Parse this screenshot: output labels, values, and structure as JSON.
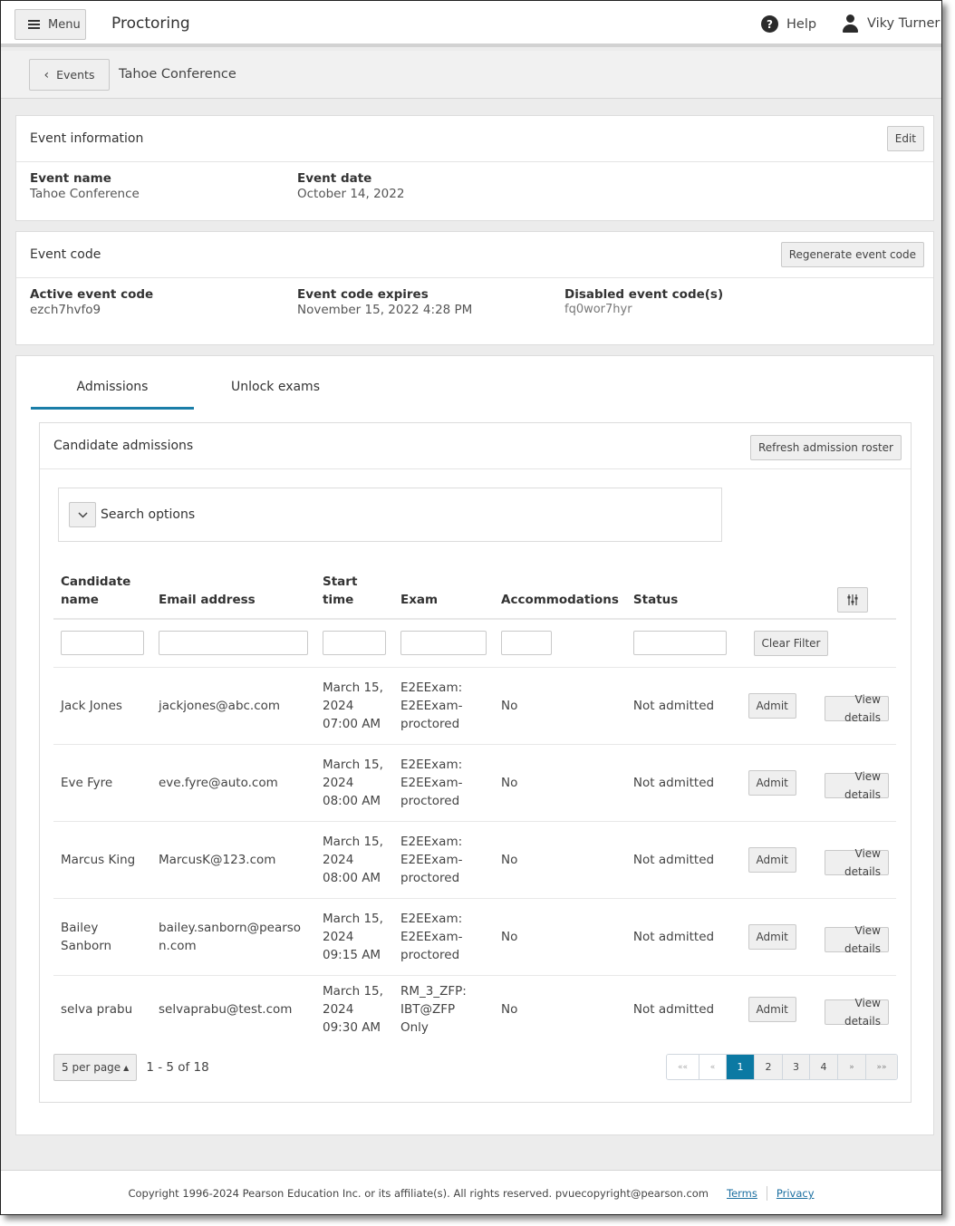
{
  "header": {
    "menu_label": "Menu",
    "app_title": "Proctoring",
    "help_label": "Help",
    "user_name": "Viky Turner"
  },
  "breadcrumb": {
    "back_label": "Events",
    "current": "Tahoe Conference"
  },
  "event_info": {
    "title": "Event information",
    "edit_label": "Edit",
    "fields": [
      {
        "label": "Event name",
        "value": "Tahoe Conference"
      },
      {
        "label": "Event date",
        "value": "October 14, 2022"
      }
    ]
  },
  "event_code": {
    "title": "Event code",
    "regenerate_label": "Regenerate event code",
    "fields": [
      {
        "label": "Active event code",
        "value": "ezch7hvfo9"
      },
      {
        "label": "Event code expires",
        "value": "November 15, 2022 4:28 PM"
      },
      {
        "label": "Disabled event code(s)",
        "value": "fq0wor7hyr"
      }
    ]
  },
  "tabs": [
    {
      "label": "Admissions",
      "active": true
    },
    {
      "label": "Unlock exams",
      "active": false
    }
  ],
  "admissions": {
    "title": "Candidate admissions",
    "refresh_label": "Refresh admission roster",
    "search_options_label": "Search options",
    "columns": [
      "Candidate name",
      "Email address",
      "Start time",
      "Exam",
      "Accommodations",
      "Status"
    ],
    "clear_filter_label": "Clear Filter",
    "admit_label": "Admit",
    "view_details_label": "View details",
    "rows": [
      {
        "name": "Jack Jones",
        "email": "jackjones@abc.com",
        "start": "March 15, 2024 07:00 AM",
        "exam": "E2EExam: E2EExam-proctored",
        "accommodations": "No",
        "status": "Not admitted"
      },
      {
        "name": "Eve Fyre",
        "email": "eve.fyre@auto.com",
        "start": "March 15, 2024 08:00 AM",
        "exam": "E2EExam: E2EExam-proctored",
        "accommodations": "No",
        "status": "Not admitted"
      },
      {
        "name": "Marcus King",
        "email": "MarcusK@123.com",
        "start": "March 15, 2024 08:00 AM",
        "exam": "E2EExam: E2EExam-proctored",
        "accommodations": "No",
        "status": "Not admitted"
      },
      {
        "name": "Bailey Sanborn",
        "email": "bailey.sanborn@pearson.com",
        "start": "March 15, 2024 09:15 AM",
        "exam": "E2EExam: E2EExam-proctored",
        "accommodations": "No",
        "status": "Not admitted"
      },
      {
        "name": "selva prabu",
        "email": "selvaprabu@test.com",
        "start": "March 15, 2024 09:30 AM",
        "exam": "RM_3_ZFP: IBT@ZFP Only",
        "accommodations": "No",
        "status": "Not admitted"
      }
    ],
    "pagination": {
      "per_page_label": "5 per page",
      "range_text": "1 - 5 of 18",
      "first": "««",
      "prev": "«",
      "pages": [
        "1",
        "2",
        "3",
        "4"
      ],
      "current_page": "1",
      "next": "»",
      "last": "»»"
    }
  },
  "footer": {
    "copyright": "Copyright 1996-2024 Pearson Education Inc. or its affiliate(s). All rights reserved. pvuecopyright@pearson.com",
    "terms_label": "Terms",
    "privacy_label": "Privacy"
  },
  "colors": {
    "accent": "#0b79a3",
    "tab_underline": "#1a7ea8",
    "link": "#1a6ea0"
  }
}
